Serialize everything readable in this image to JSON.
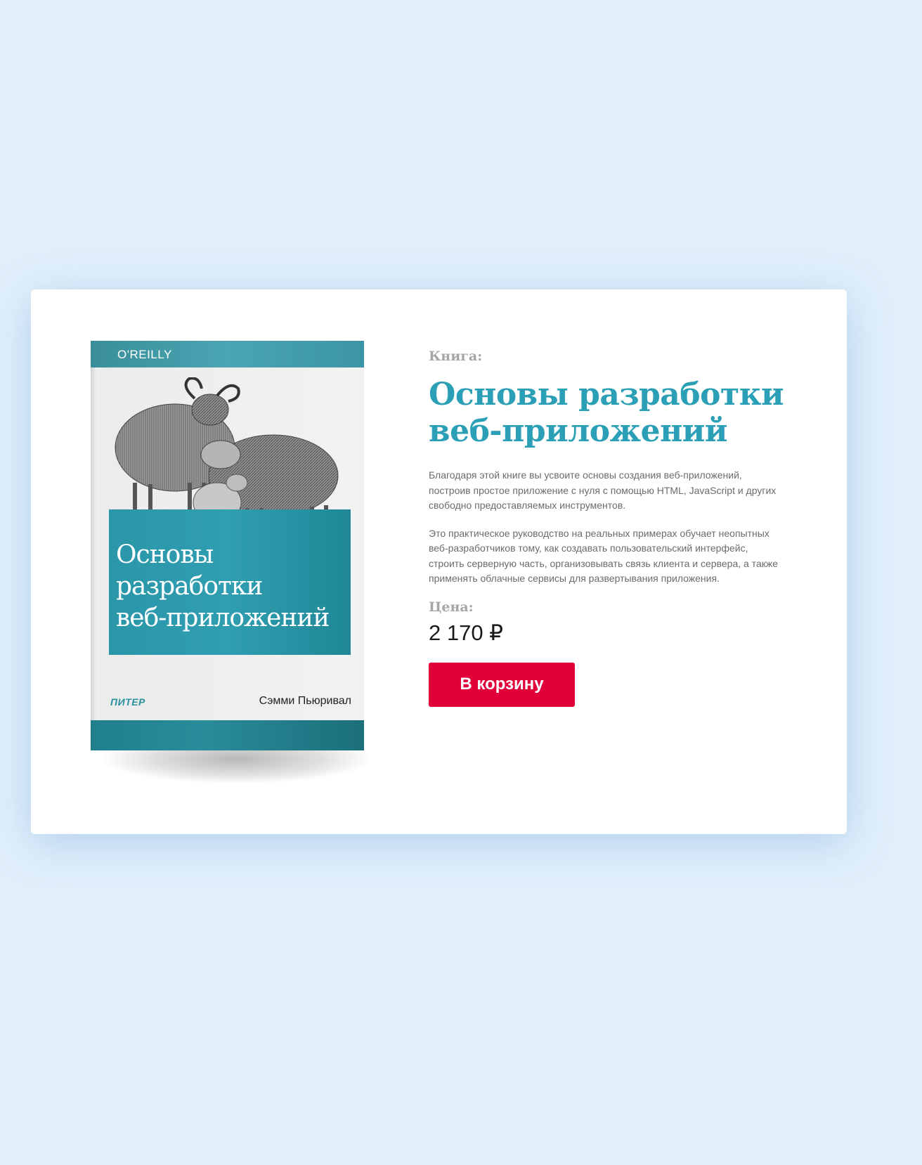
{
  "book": {
    "label": "Книга:",
    "title_lines": [
      "Основы разработки",
      "веб-приложений"
    ],
    "description": [
      "Благодаря этой книге вы усвоите основы создания веб-приложений, построив простое приложение с нуля с помощью HTML, JavaScript и других свободно предоставляемых инструментов.",
      "Это практическое руководство на реальных примерах обучает неопытных веб-разработчиков тому, как создавать пользовательский интерфейс, строить серверную часть, организовывать связь клиента и сервера, а также применять облачные сервисы для развертывания приложения."
    ],
    "price_label": "Цена:",
    "price": "2 170 ₽",
    "buy_label": "В корзину"
  },
  "cover": {
    "publisher_top": "O'REILLY",
    "title_lines": [
      "Основы",
      "разработки",
      "веб-приложений"
    ],
    "publisher_bottom": "ПИТЕР",
    "author": "Сэмми Пьюривал",
    "illustration": "sheep-illustration"
  },
  "colors": {
    "background": "#e1effb",
    "title_accent": "#2a9fb5",
    "button": "#e2003a",
    "cover_teal": "#2f9eb0"
  }
}
